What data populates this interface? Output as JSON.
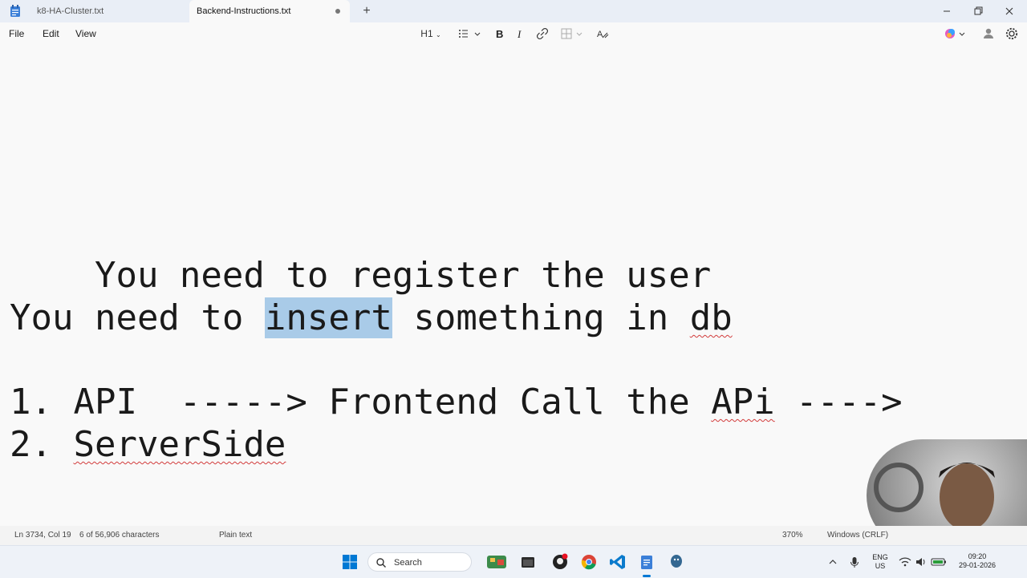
{
  "tabs": [
    {
      "label": "k8-HA-Cluster.txt",
      "active": false
    },
    {
      "label": "Backend-Instructions.txt",
      "active": true
    }
  ],
  "menu": {
    "file": "File",
    "edit": "Edit",
    "view": "View"
  },
  "toolbar": {
    "heading": "H1"
  },
  "editor": {
    "line1": "You need to register the user",
    "line2_pre": "You need to ",
    "line2_sel": "insert",
    "line2_mid": " something in ",
    "line2_db": "db",
    "line3_pre": "1. API  -----> Frontend Call the ",
    "line3_api": "APi",
    "line3_post": " ---->",
    "line4_pre": "2. ",
    "line4_word": "ServerSide"
  },
  "status": {
    "position": "Ln 3734, Col 19",
    "chars": "6 of 56,906 characters",
    "format": "Plain text",
    "zoom": "370%",
    "eol": "Windows (CRLF)"
  },
  "taskbar": {
    "search_label": "Search",
    "lang_line1": "ENG",
    "lang_line2": "US",
    "time": "09:20",
    "date": "29-01-2026"
  },
  "colors": {
    "selection": "#a9cbe8",
    "spellcheck": "#d23b3b",
    "accent": "#0078d4"
  }
}
